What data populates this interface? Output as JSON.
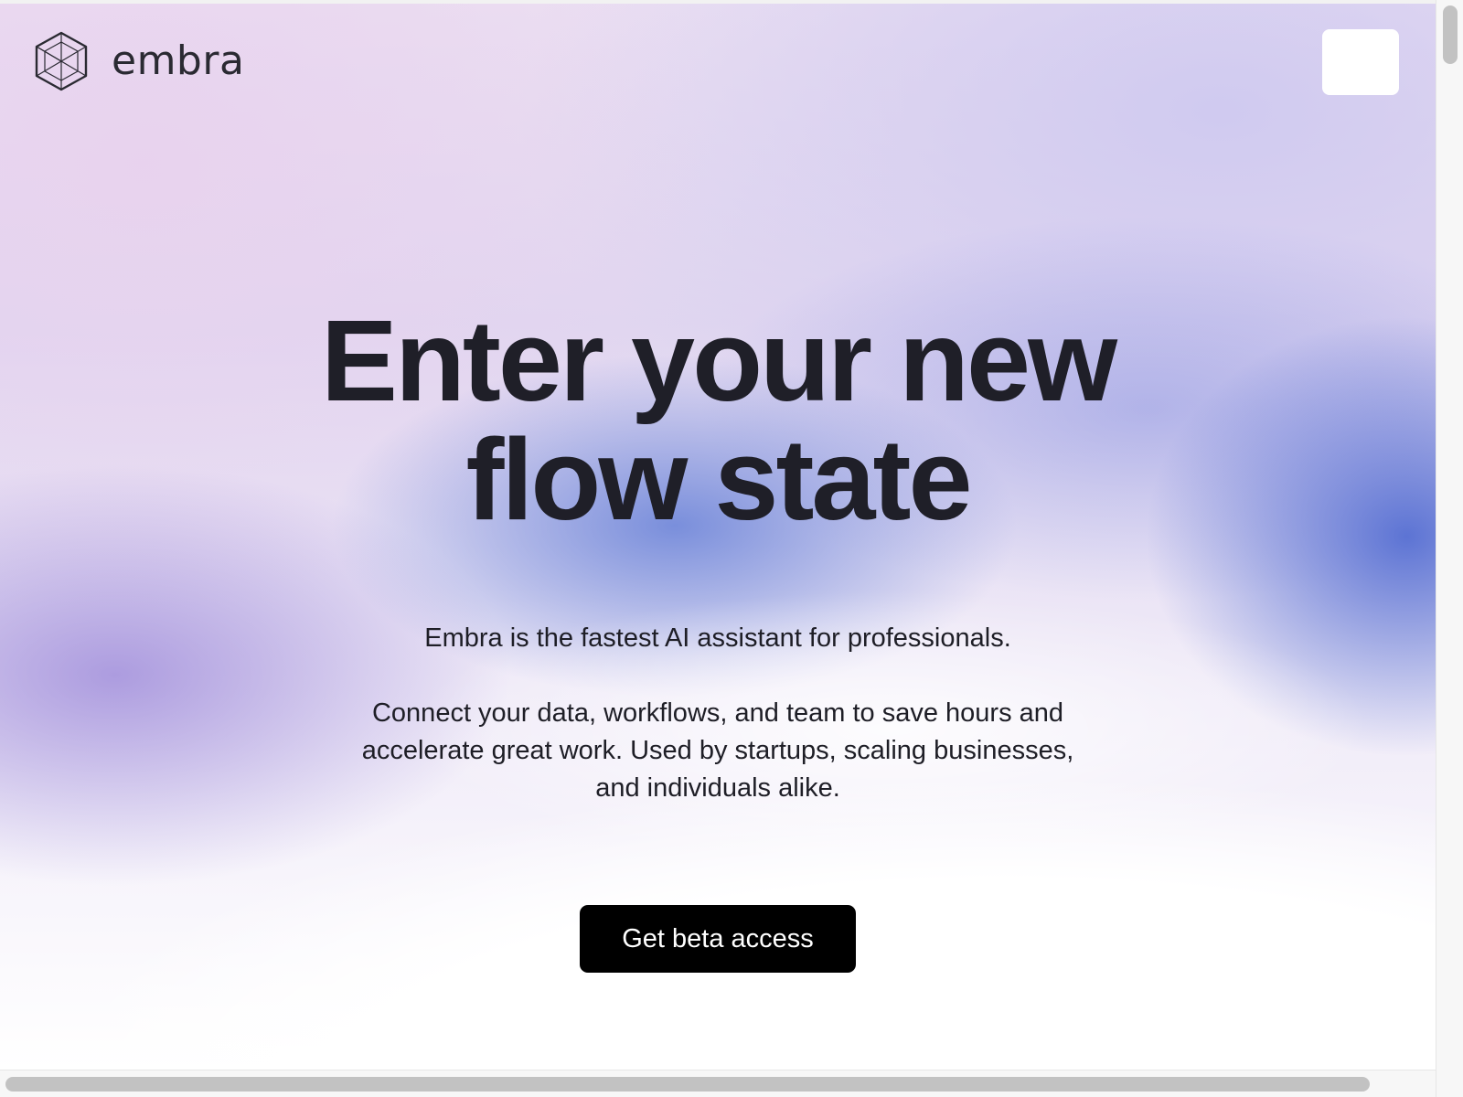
{
  "header": {
    "logo_icon": "cube-wireframe-icon",
    "brand_name": "embra",
    "menu_button_icon": "blank-menu-icon"
  },
  "hero": {
    "title_line_1": "Enter your new",
    "title_line_2": "flow state",
    "tagline": "Embra is the fastest AI assistant for professionals.",
    "description": "Connect your data, workflows, and team to save hours and accelerate great work. Used by startups, scaling businesses, and individuals alike.",
    "cta_label": "Get beta access"
  },
  "colors": {
    "text_dark": "#1f1f28",
    "cta_background": "#000000",
    "cta_text": "#ffffff",
    "gradient_lilac": "#e8d2ee",
    "gradient_blue": "#6680d7"
  }
}
